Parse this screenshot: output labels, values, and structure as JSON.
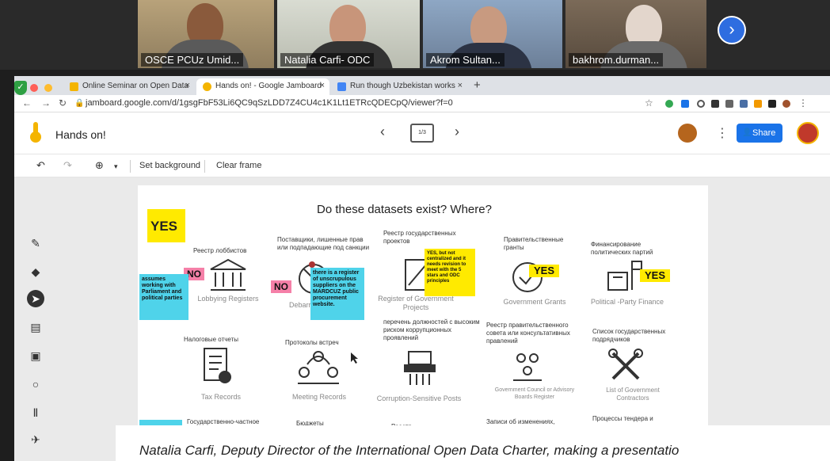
{
  "video_strip": {
    "participants": [
      {
        "name": "OSCE PCUz Umid..."
      },
      {
        "name": "Natalia Carfi- ODC"
      },
      {
        "name": "Akrom Sultan..."
      },
      {
        "name": "bakhrom.durman..."
      }
    ]
  },
  "browser": {
    "tabs": [
      {
        "label": "Online Seminar on Open Data"
      },
      {
        "label": "Hands on! - Google Jamboard"
      },
      {
        "label": "Run though Uzbekistan works"
      }
    ],
    "url": "jamboard.google.com/d/1gsgFbF53Li6QC9qSzLDD7Z4CU4c1K1Lt1ETRcQDECpQ/viewer?f=0"
  },
  "jamboard": {
    "title": "Hands on!",
    "frame_counter": "1/3",
    "share_label": "Share",
    "toolbar": {
      "set_background": "Set background",
      "clear_frame": "Clear frame"
    },
    "frame": {
      "title": "Do these datasets exist? Where?",
      "yes_big": "YES",
      "cells": [
        {
          "ru": "Реестр лоббистов",
          "en": "Lobbying Registers"
        },
        {
          "ru": "Поставщики, лишенные прав или подпадающие под санкции",
          "en": "Debarred ... con..."
        },
        {
          "ru": "Реестр государственных проектов",
          "en": "Register of Government Projects"
        },
        {
          "ru": "Правительственные гранты",
          "en": "Government Grants"
        },
        {
          "ru": "Финансирование политических партий",
          "en": "Political -Party Finance"
        },
        {
          "ru": "Налоговые отчеты",
          "en": "Tax Records"
        },
        {
          "ru": "Протоколы встреч",
          "en": "Meeting Records"
        },
        {
          "ru": "перечень должностей с высоким риском коррупционных проявлений",
          "en": "Corruption-Sensitive Posts"
        },
        {
          "ru": "Реестр правительственного совета или консультативных правлений",
          "en": "Government Council or Advisory Boards Register"
        },
        {
          "ru": "Список государственных подрядчиков",
          "en": "List of Government Contractors"
        },
        {
          "ru": "Государственно-частное",
          "en": ""
        },
        {
          "ru": "Бюджеты",
          "en": ""
        },
        {
          "ru": "Реестр",
          "en": ""
        },
        {
          "ru": "Записи об изменениях,",
          "en": ""
        },
        {
          "ru": "Процессы тендера и",
          "en": ""
        }
      ],
      "stickies": {
        "cyan_left": "assumes working with Parliament and political parties",
        "cyan_mid": "there is a register of unscrupulous suppliers on the MARDCUZ public procurement website.",
        "yellow_projects": "YES, but not centralized and it needs revision to meet with the 5 stars and ODC principles",
        "no1": "NO",
        "no2": "NO",
        "yes_grants": "YES",
        "yes_party": "YES"
      }
    }
  },
  "caption": "Natalia Carfi, Deputy Director of the International Open Data Charter, making a presentatio"
}
